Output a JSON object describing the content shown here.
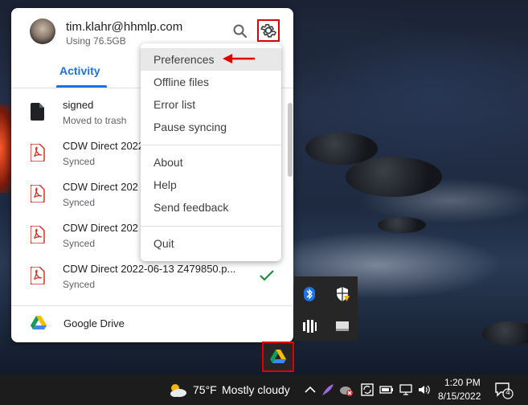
{
  "account": {
    "email": "tim.klahr@hhmlp.com",
    "usage": "Using 76.5GB"
  },
  "tabs": {
    "activity": "Activity"
  },
  "activity_items": [
    {
      "name": "signed",
      "status": "Moved to trash",
      "icon": "file-icon"
    },
    {
      "name": "CDW Direct 2022",
      "status": "Synced",
      "icon": "pdf-icon"
    },
    {
      "name": "CDW Direct 202",
      "status": "Synced",
      "icon": "pdf-icon"
    },
    {
      "name": "CDW Direct 202",
      "status": "Synced",
      "icon": "pdf-icon"
    },
    {
      "name": "CDW Direct 2022-06-13 Z479850.p...",
      "status": "Synced",
      "icon": "pdf-icon",
      "synced_check": true
    }
  ],
  "footer": {
    "label": "Google Drive"
  },
  "menu": {
    "items_group1": [
      "Preferences",
      "Offline files",
      "Error list",
      "Pause syncing"
    ],
    "items_group2": [
      "About",
      "Help",
      "Send feedback"
    ],
    "items_group3": [
      "Quit"
    ],
    "active": "Preferences"
  },
  "taskbar": {
    "temperature": "75°F",
    "condition": "Mostly cloudy",
    "time": "1:20 PM",
    "date": "8/15/2022",
    "notification_count": "4"
  },
  "colors": {
    "accent": "#1a73e8",
    "highlight_box": "#e00000",
    "check": "#1e8e3e"
  }
}
